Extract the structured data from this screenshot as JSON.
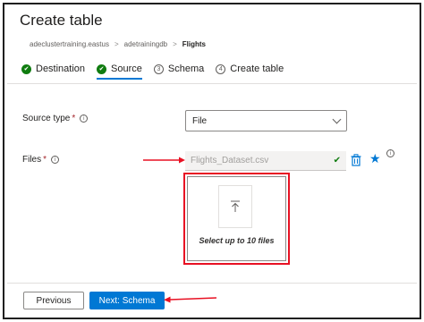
{
  "dialog": {
    "title": "Create table"
  },
  "breadcrumb": {
    "cluster": "adeclustertraining.eastus",
    "database": "adetrainingdb",
    "current": "Flights"
  },
  "steps": [
    {
      "label": "Destination",
      "status": "done"
    },
    {
      "label": "Source",
      "status": "active",
      "number": ""
    },
    {
      "label": "Schema",
      "status": "todo",
      "number": "3"
    },
    {
      "label": "Create table",
      "status": "todo",
      "number": "4"
    }
  ],
  "form": {
    "source_type_label": "Source type",
    "source_type_value": "File",
    "required_mark": "*",
    "files_label": "Files",
    "file_name": "Flights_Dataset.csv",
    "dropzone_text": "Select up to 10 files"
  },
  "footer": {
    "previous_label": "Previous",
    "next_label": "Next: Schema"
  },
  "colors": {
    "accent": "#0078d4",
    "success": "#107c10",
    "highlight": "#e81123"
  }
}
